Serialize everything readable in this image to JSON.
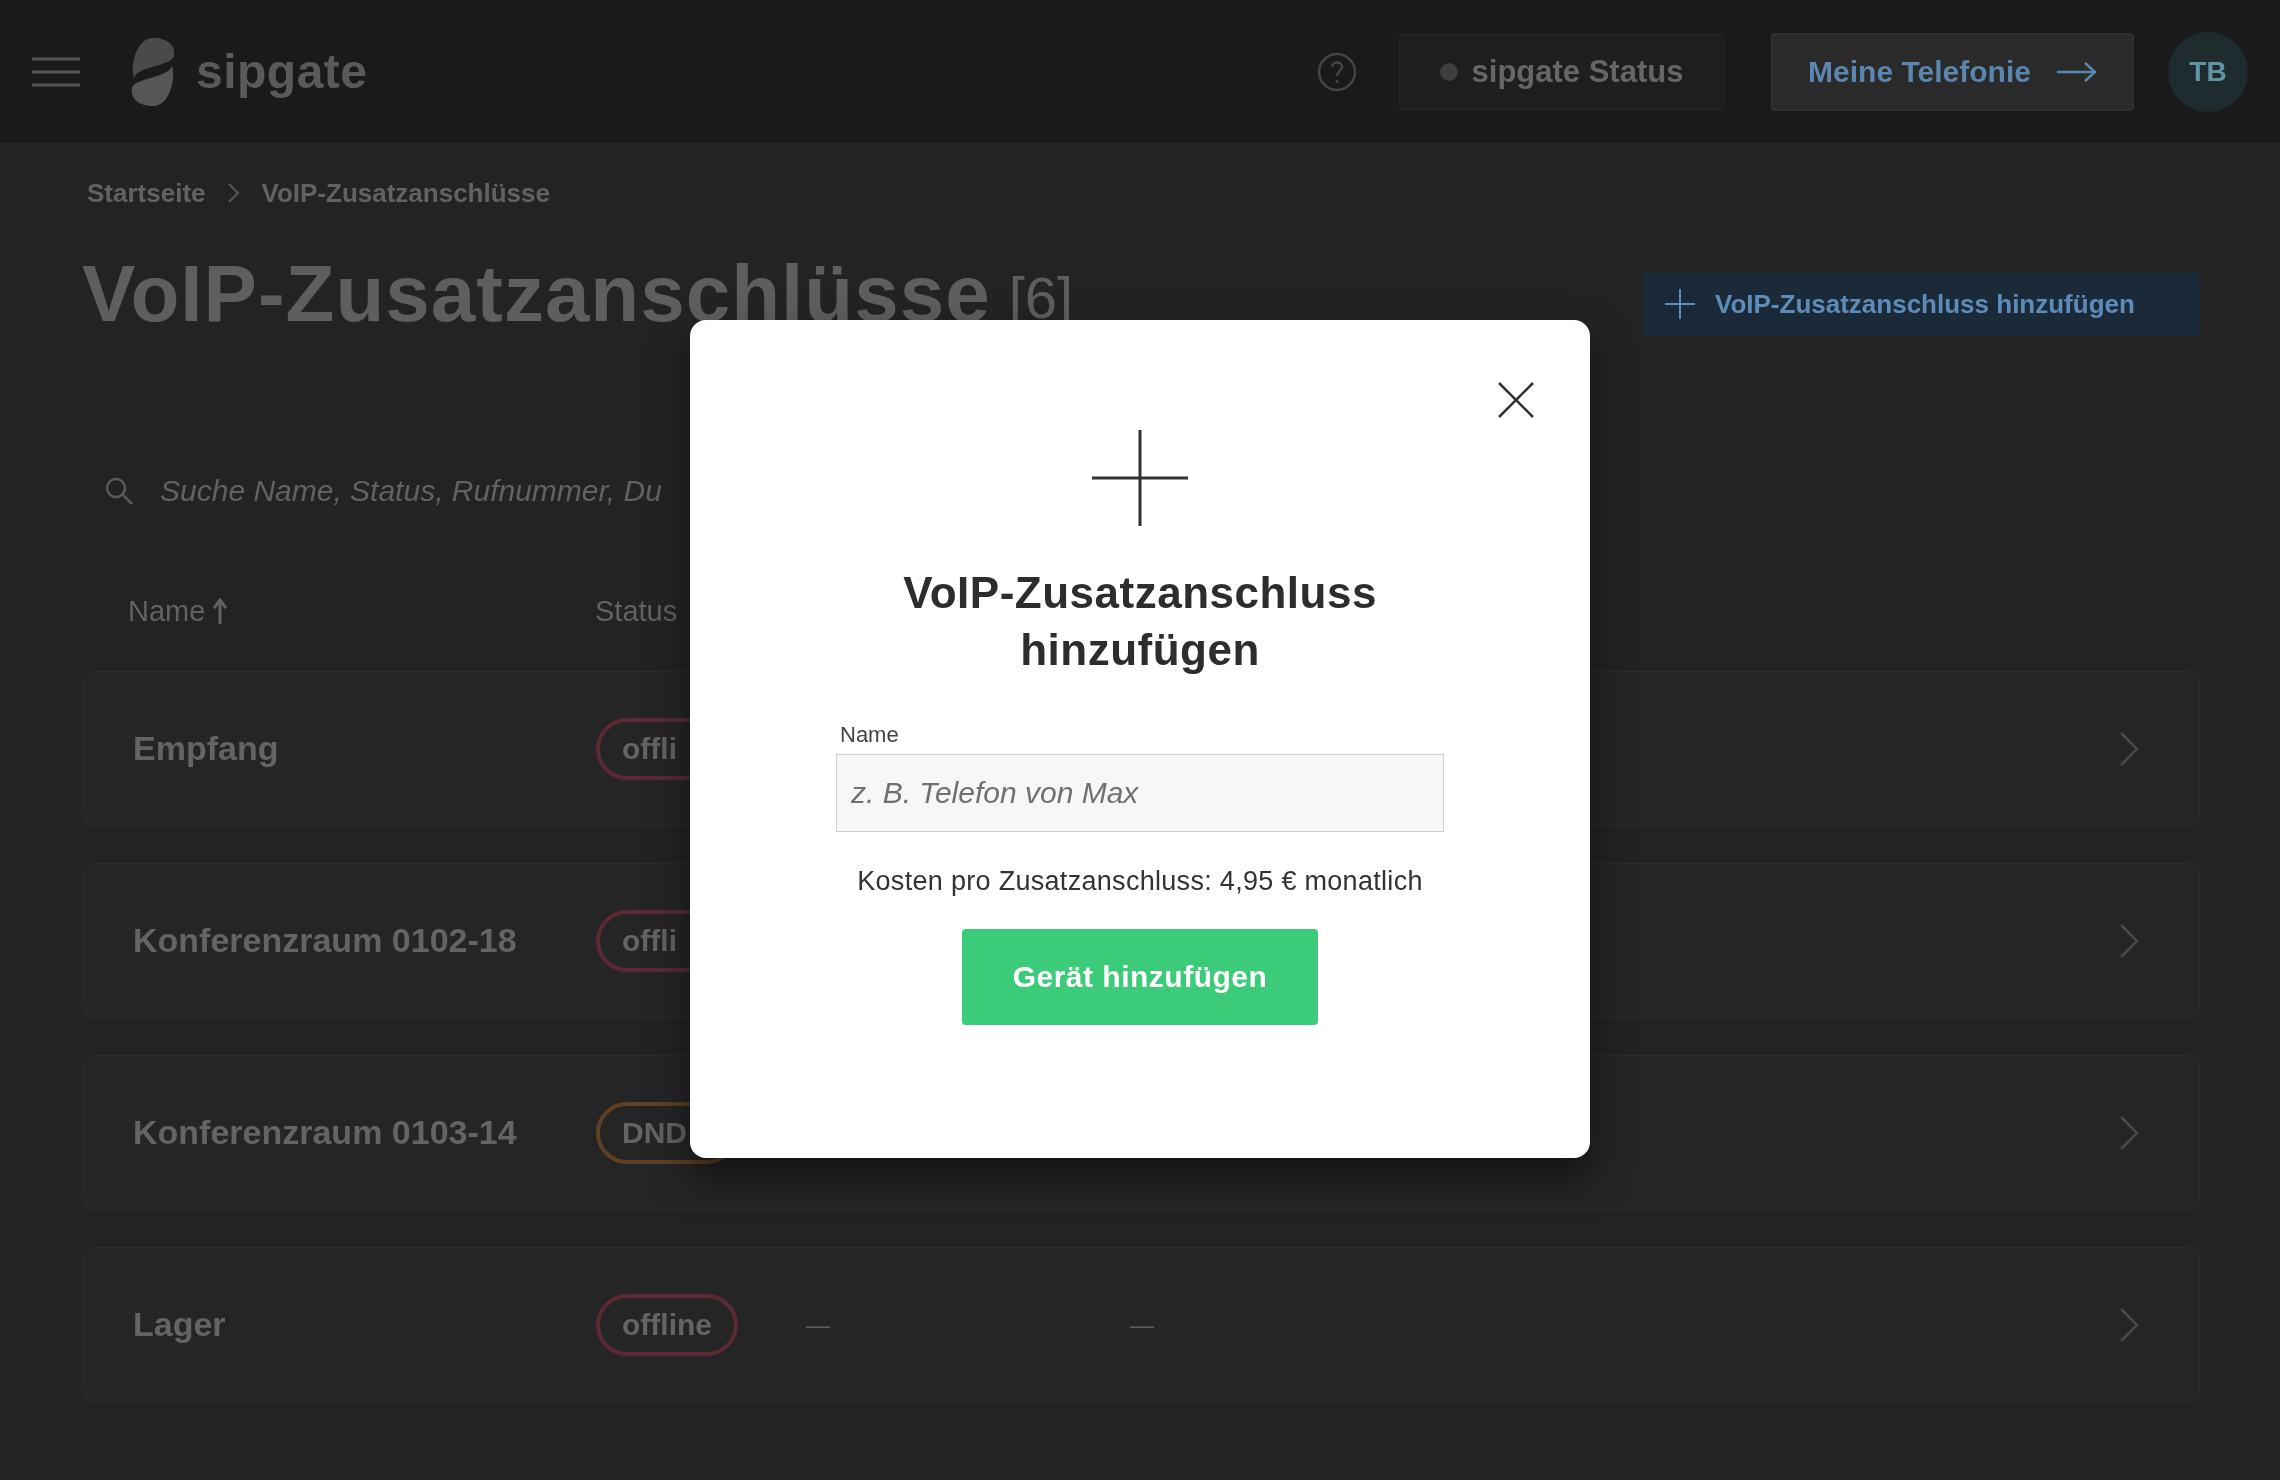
{
  "header": {
    "logo": "sipgate",
    "status_button": "sipgate Status",
    "telephony_button": "Meine Telefonie",
    "avatar": "TB"
  },
  "breadcrumb": [
    "Startseite",
    "VoIP-Zusatzanschlüsse"
  ],
  "page_title": "VoIP-Zusatzanschlüsse",
  "count": "[6]",
  "add_button": "VoIP-Zusatzanschluss hinzufügen",
  "search": {
    "placeholder": "Suche Name, Status, Rufnummer, Du"
  },
  "table": {
    "columns": [
      {
        "label": "Name",
        "sorted": true
      },
      {
        "label": "Status",
        "sorted": false
      }
    ],
    "rows": [
      {
        "name": "Empfang",
        "status": {
          "label": "offli",
          "kind": "offline"
        }
      },
      {
        "name": "Konferenzraum 0102-18",
        "status": {
          "label": "offli",
          "kind": "offline"
        }
      },
      {
        "name": "Konferenzraum 0103-14",
        "status": {
          "label": "DND",
          "kind": "dnd"
        }
      },
      {
        "name": "Lager",
        "status": {
          "label": "offline",
          "kind": "offline"
        },
        "column_3": "—",
        "column_4": "—"
      }
    ]
  },
  "dialog": {
    "title": "VoIP-Zusatzanschluss hinzufügen",
    "field": {
      "label": "Name",
      "placeholder": "z. B. Telefon von Max"
    },
    "cost": "Kosten pro Zusatzanschluss: 4,95 € monatlich",
    "submit": "Gerät hinzufügen"
  }
}
